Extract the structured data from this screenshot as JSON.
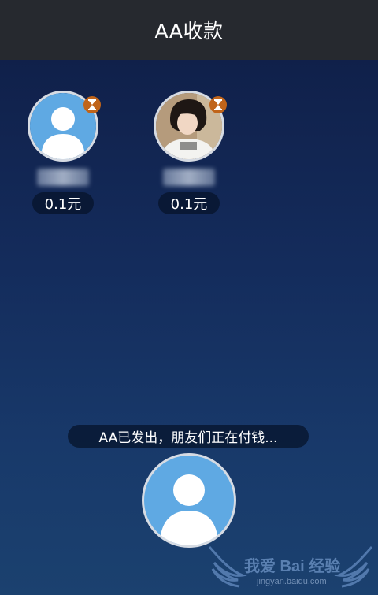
{
  "header": {
    "title": "AA收款"
  },
  "members": [
    {
      "avatar": "default-person-avatar",
      "badge_icon": "hourglass-icon",
      "name": "",
      "amount": "0.1元"
    },
    {
      "avatar": "photo-avatar",
      "badge_icon": "hourglass-icon",
      "name": "",
      "amount": "0.1元"
    }
  ],
  "status": {
    "message": "AA已发出，朋友们正在付钱..."
  },
  "me": {
    "avatar": "default-person-avatar"
  },
  "watermark": {
    "text": "我爱 Bai 经验",
    "url": "jingyan.baidu.com"
  },
  "colors": {
    "header_bg": "#26292f",
    "background_top": "#0f1d45",
    "background_bottom": "#1b416f",
    "avatar_blue": "#5fa9e3",
    "badge_orange": "#c0641a",
    "pill_bg": "#061228"
  }
}
